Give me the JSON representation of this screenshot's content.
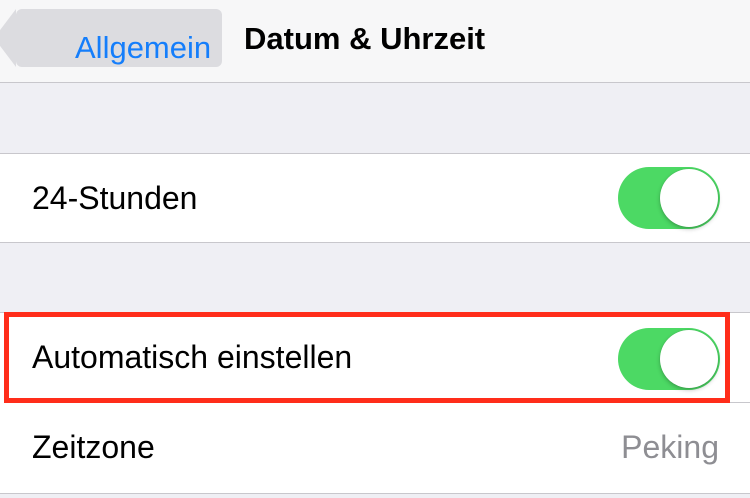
{
  "navbar": {
    "back_label": "Allgemein",
    "title": "Datum & Uhrzeit"
  },
  "rows": [
    {
      "label": "24-Stunden",
      "toggle_on": true
    },
    {
      "label": "Automatisch einstellen",
      "toggle_on": true,
      "highlighted": true
    },
    {
      "label": "Zeitzone",
      "value": "Peking"
    }
  ],
  "colors": {
    "accent": "#157efb",
    "toggle_on": "#4cd964",
    "highlight": "#ff2d1a",
    "background": "#efeff4"
  }
}
